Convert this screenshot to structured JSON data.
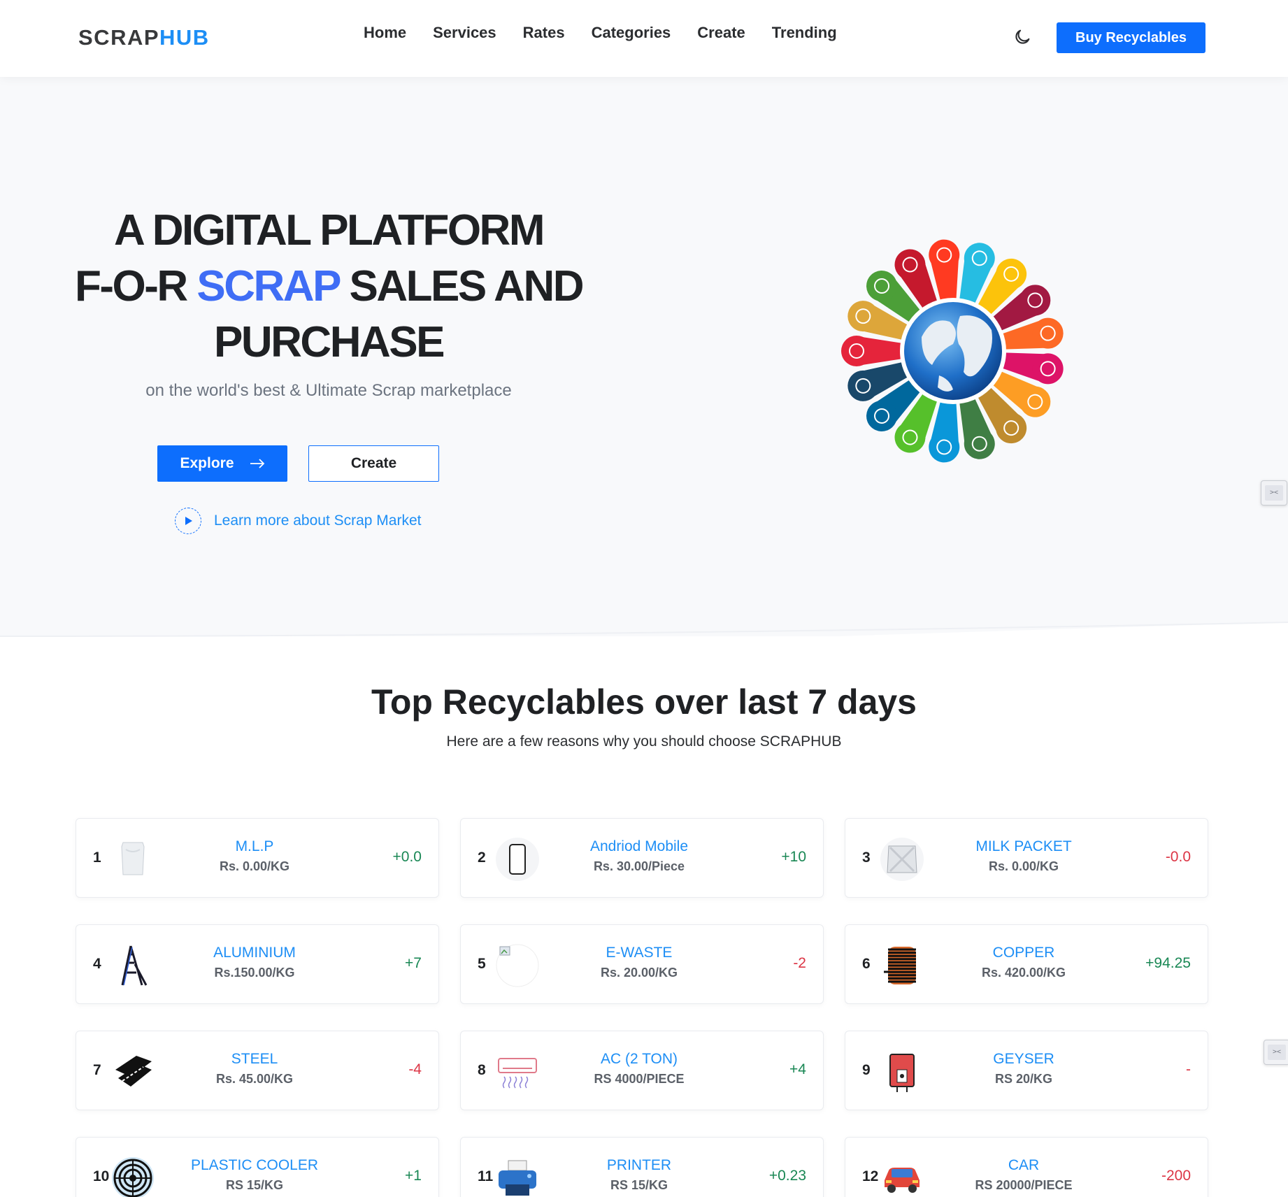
{
  "brand": {
    "part1": "SCRAP",
    "part2": "HUB"
  },
  "nav": [
    "Home",
    "Services",
    "Rates",
    "Categories",
    "Create",
    "Trending"
  ],
  "header": {
    "buy_label": "Buy Recyclables",
    "theme_icon": "moon-icon"
  },
  "hero": {
    "line1": "A DIGITAL PLATFORM",
    "line2_pre": "F-O-R ",
    "line2_accent": "SCRAP",
    "line2_post": " SALES AND",
    "line3": "PURCHASE",
    "subtitle": "on the world's best & Ultimate Scrap marketplace",
    "explore_label": "Explore",
    "create_label": "Create",
    "learn_label": "Learn more about Scrap Market"
  },
  "section": {
    "title": "Top Recyclables over last 7 days",
    "subtitle": "Here are a few reasons why you should choose SCRAPHUB"
  },
  "items": [
    {
      "rank": "1",
      "name": "M.L.P",
      "price": "Rs. 0.00/KG",
      "delta": "+0.0",
      "trend": "pos",
      "icon": "plastic-bag-icon"
    },
    {
      "rank": "2",
      "name": "Andriod Mobile",
      "price": "Rs. 30.00/Piece",
      "delta": "+10",
      "trend": "pos",
      "icon": "mobile-phone-icon"
    },
    {
      "rank": "3",
      "name": "MILK PACKET",
      "price": "Rs. 0.00/KG",
      "delta": "-0.0",
      "trend": "neg",
      "icon": "milk-packet-icon"
    },
    {
      "rank": "4",
      "name": "ALUMINIUM",
      "price": "Rs.150.00/KG",
      "delta": "+7",
      "trend": "pos",
      "icon": "ladder-icon"
    },
    {
      "rank": "5",
      "name": "E-WASTE",
      "price": "Rs. 20.00/KG",
      "delta": "-2",
      "trend": "neg",
      "icon": "broken-image-icon"
    },
    {
      "rank": "6",
      "name": "COPPER",
      "price": "Rs. 420.00/KG",
      "delta": "+94.25",
      "trend": "pos",
      "icon": "copper-coil-icon"
    },
    {
      "rank": "7",
      "name": "STEEL",
      "price": "Rs. 45.00/KG",
      "delta": "-4",
      "trend": "neg",
      "icon": "steel-beam-icon"
    },
    {
      "rank": "8",
      "name": "AC (2 TON)",
      "price": "RS 4000/PIECE",
      "delta": "+4",
      "trend": "pos",
      "icon": "air-conditioner-icon"
    },
    {
      "rank": "9",
      "name": "GEYSER",
      "price": "RS 20/KG",
      "delta": "-",
      "trend": "neg",
      "icon": "geyser-icon"
    },
    {
      "rank": "10",
      "name": "PLASTIC COOLER",
      "price": "RS 15/KG",
      "delta": "+1",
      "trend": "pos",
      "icon": "fan-grill-icon"
    },
    {
      "rank": "11",
      "name": "PRINTER",
      "price": "RS 15/KG",
      "delta": "+0.23",
      "trend": "pos",
      "icon": "printer-icon"
    },
    {
      "rank": "12",
      "name": "CAR",
      "price": "RS 20000/PIECE",
      "delta": "-200",
      "trend": "neg",
      "icon": "car-icon"
    }
  ],
  "colors": {
    "primary": "#0d6efd",
    "link": "#1d8ef5",
    "positive": "#198754",
    "negative": "#dc3545"
  }
}
